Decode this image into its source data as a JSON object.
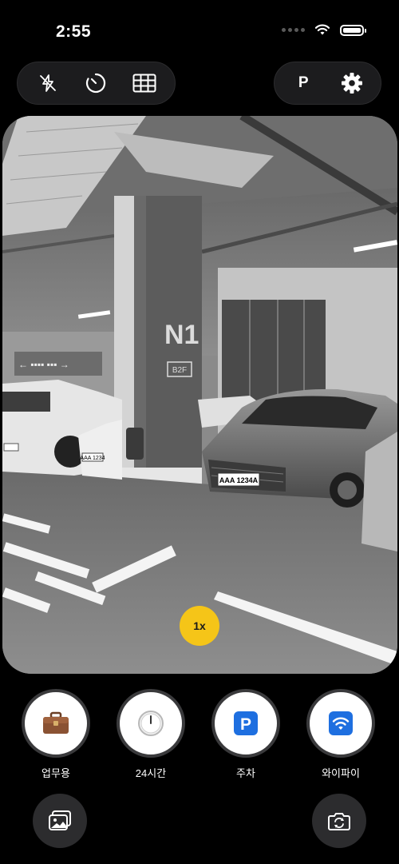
{
  "status_bar": {
    "time": "2:55"
  },
  "toolbar": {
    "left_tools": [
      "flash-off-icon",
      "timer-icon",
      "grid-icon"
    ],
    "mode_label": "P",
    "settings_icon": "gear-icon"
  },
  "viewfinder": {
    "scene": "parking-garage",
    "pillar_label": "N1",
    "pillar_sublabel": "B2F",
    "plate_left": "AAA 1234A",
    "plate_small": "AAA 1234",
    "plate_tiny": "AAA 1234"
  },
  "zoom": {
    "label": "1x",
    "color": "#f5c518"
  },
  "shortcuts": [
    {
      "label": "업무용",
      "icon": "briefcase-icon"
    },
    {
      "label": "24시간",
      "icon": "clock-icon"
    },
    {
      "label": "주차",
      "icon": "parking-icon"
    },
    {
      "label": "와이파이",
      "icon": "wifi-icon"
    }
  ],
  "bottom": {
    "gallery_icon": "gallery-icon",
    "switch_icon": "camera-switch-icon"
  },
  "colors": {
    "accent": "#f5c518",
    "blue": "#1e6fe0"
  }
}
